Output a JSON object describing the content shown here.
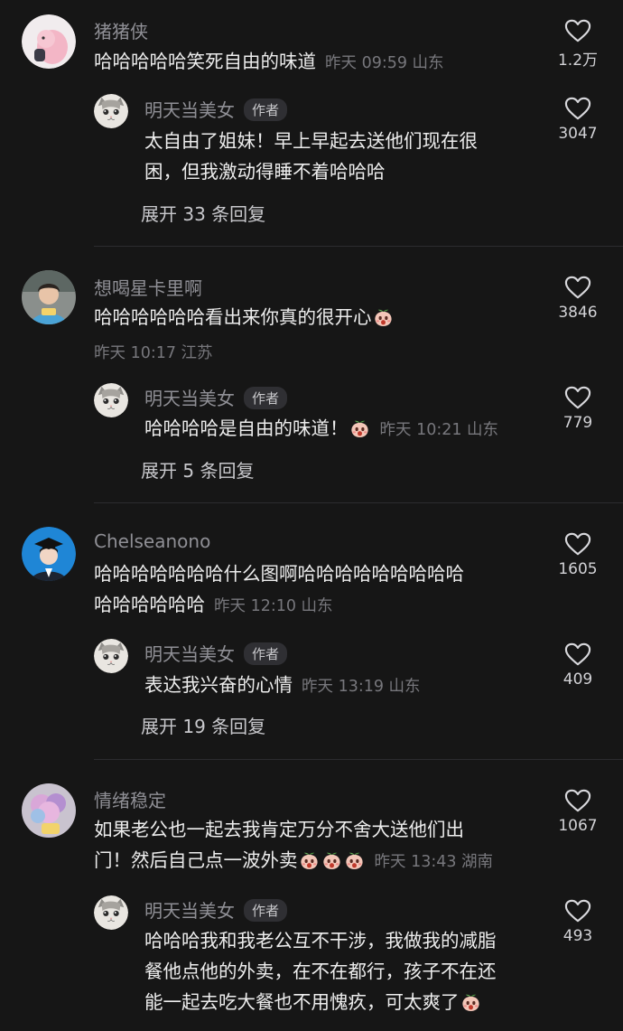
{
  "comments": [
    {
      "user": "猪猪侠",
      "text_lines": [
        "哈哈哈哈哈笑死自由的味道"
      ],
      "time": "昨天 09:59 山东",
      "likes": "1.2万",
      "reply": {
        "user": "明天当美女",
        "badge": "作者",
        "text_lines": [
          "太自由了姐妹！早上早起去送他们现在很",
          "困，但我激动得睡不着哈哈哈"
        ],
        "likes": "3047"
      },
      "expand": "展开 33 条回复"
    },
    {
      "user": "想喝星卡里啊",
      "text_lines": [
        "哈哈哈哈哈哈看出来你真的很开心"
      ],
      "time": "昨天 10:17 江苏",
      "likes": "3846",
      "reply": {
        "user": "明天当美女",
        "badge": "作者",
        "text_lines": [
          "哈哈哈哈是自由的味道！"
        ],
        "time": "昨天 10:21 山东",
        "likes": "779"
      },
      "expand": "展开 5 条回复"
    },
    {
      "user": "Chelseanono",
      "text_lines": [
        "哈哈哈哈哈哈哈什么图啊哈哈哈哈哈哈哈哈哈",
        "哈哈哈哈哈哈"
      ],
      "time": "昨天 12:10 山东",
      "likes": "1605",
      "reply": {
        "user": "明天当美女",
        "badge": "作者",
        "text_lines": [
          "表达我兴奋的心情"
        ],
        "time": "昨天 13:19 山东",
        "likes": "409"
      },
      "expand": "展开 19 条回复"
    },
    {
      "user": "情绪稳定",
      "text_lines": [
        "如果老公也一起去我肯定万分不舍大送他们出",
        "门！然后自己点一波外卖"
      ],
      "time": "昨天 13:43 湖南",
      "likes": "1067",
      "reply": {
        "user": "明天当美女",
        "badge": "作者",
        "text_lines": [
          "哈哈哈我和我老公互不干涉，我做我的减脂",
          "餐他点他的外卖，在不在都行，孩子不在还",
          "能一起去吃大餐也不用愧疚，可太爽了"
        ],
        "likes": "493"
      }
    }
  ],
  "icons": {
    "like": "heart-outline-icon",
    "emoji": "peach-emoji-icon"
  },
  "colors": {
    "background": "#161616",
    "text": "#ededed",
    "muted": "#8f8f95",
    "badge_bg": "#2f2f33"
  }
}
